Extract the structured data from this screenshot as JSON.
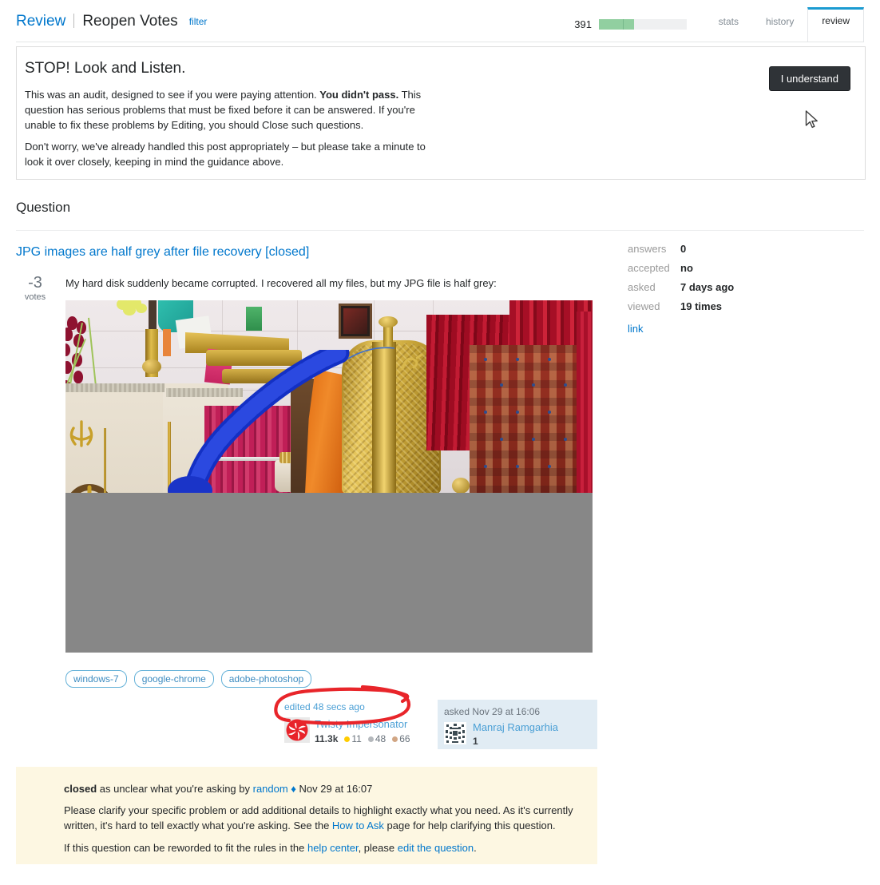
{
  "header": {
    "review_link": "Review",
    "queue_name": "Reopen Votes",
    "filter_link": "filter",
    "progress_count": "391",
    "progress_percent": 40,
    "progress_tick_percent": 27,
    "tabs": [
      {
        "label": "stats",
        "active": false
      },
      {
        "label": "history",
        "active": false
      },
      {
        "label": "review",
        "active": true
      }
    ]
  },
  "audit_notice": {
    "title": "STOP! Look and Listen.",
    "paragraph1_a": "This was an audit, designed to see if you were paying attention. ",
    "paragraph1_bold": "You didn't pass.",
    "paragraph1_b": " This question has serious problems that must be fixed before it can be answered. If you're unable to fix these problems by Editing, you should Close such questions.",
    "paragraph2": "Don't worry, we've already handled this post appropriately – but please take a minute to look it over closely, keeping in mind the guidance above.",
    "button_label": "I understand",
    "button_color": "#2f3337"
  },
  "section": {
    "heading": "Question"
  },
  "question": {
    "title": "JPG images are half grey after file recovery [closed]",
    "vote_count": "-3",
    "vote_label": "votes",
    "body": "My hard disk suddenly became corrupted. I recovered all my files, but my JPG file is half grey:",
    "image_alt": "gurdwara interior photo with bottom half corrupted to solid grey",
    "image_grey_color": "#878787",
    "tags": [
      "windows-7",
      "google-chrome",
      "adobe-photoshop"
    ]
  },
  "stats": {
    "rows": [
      {
        "key": "answers",
        "value": "0"
      },
      {
        "key": "accepted",
        "value": "no"
      },
      {
        "key": "asked",
        "value": "7 days ago"
      },
      {
        "key": "viewed",
        "value": "19 times"
      }
    ],
    "link_label": "link"
  },
  "edit_card": {
    "edited_link": "edited 48 secs ago",
    "user_name": "Twisty Impersonator",
    "reputation": "11.3k",
    "gold_badges": "11",
    "silver_badges": "48",
    "bronze_badges": "66",
    "avatar_icon": "pinwheel-swirl-avatar"
  },
  "ask_card": {
    "asked_label": "asked Nov 29 at 16:06",
    "user_name": "Manraj Ramgarhia",
    "reputation": "1",
    "avatar_icon": "identicon-avatar",
    "background_color": "#e1ecf4"
  },
  "annotation": {
    "shape": "hand-drawn-red-ellipse",
    "color": "#e8252a",
    "targets": "edited 48 secs ago"
  },
  "closed_notice": {
    "bold_word": "closed",
    "line1_a": " as unclear what you're asking by ",
    "line1_user": "random",
    "line1_diamond": " ♦ ",
    "line1_date": "Nov 29 at 16:07",
    "line2_a": "Please clarify your specific problem or add additional details to highlight exactly what you need. As it's currently written, it's hard to tell exactly what you're asking. See the ",
    "line2_link": "How to Ask",
    "line2_b": " page for help clarifying this question.",
    "line3_a": "If this question can be reworded to fit the rules in the ",
    "line3_link1": "help center",
    "line3_b": ", please ",
    "line3_link2": "edit the question",
    "line3_c": ".",
    "background_color": "#fdf7e2"
  },
  "cursor": {
    "icon": "mouse-pointer-arrow"
  }
}
